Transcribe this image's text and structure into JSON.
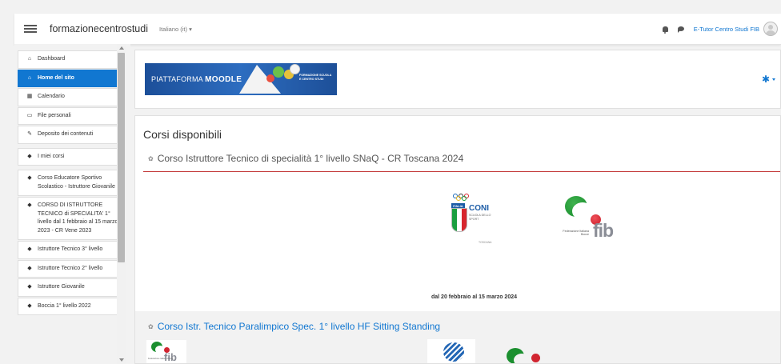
{
  "navbar": {
    "site_name": "formazionecentrostudi",
    "language": "Italiano (it) ▾",
    "user_name": "E-Tutor Centro Studi FIB"
  },
  "sidebar": {
    "items": [
      {
        "label": "Dashboard",
        "icon": "dashboard-icon",
        "glyph": "⌂"
      },
      {
        "label": "Home del sito",
        "icon": "home-icon",
        "glyph": "⌂",
        "active": true
      },
      {
        "label": "Calendario",
        "icon": "calendar-icon",
        "glyph": "▦"
      },
      {
        "label": "File personali",
        "icon": "file-icon",
        "glyph": "▭"
      },
      {
        "label": "Deposito dei contenuti",
        "icon": "pencil-icon",
        "glyph": "✎"
      },
      {
        "label": "I miei corsi",
        "icon": "graduation-cap-icon",
        "glyph": "◆"
      },
      {
        "label": "Corso Educatore Sportivo Scolastico - Istruttore Giovanile",
        "icon": "graduation-cap-icon",
        "glyph": "◆"
      },
      {
        "label": "CORSO DI ISTRUTTORE TECNICO di SPECIALITA' 1° livello dal 1 febbraio al 15 marzo 2023 - CR Vene 2023",
        "icon": "graduation-cap-icon",
        "glyph": "◆"
      },
      {
        "label": "Istruttore Tecnico 3° livello",
        "icon": "graduation-cap-icon",
        "glyph": "◆"
      },
      {
        "label": "Istruttore Tecnico 2° livello",
        "icon": "graduation-cap-icon",
        "glyph": "◆"
      },
      {
        "label": "Istruttore Giovanile",
        "icon": "graduation-cap-icon",
        "glyph": "◆"
      },
      {
        "label": "Boccia 1° livello 2022",
        "icon": "graduation-cap-icon",
        "glyph": "◆"
      }
    ]
  },
  "header": {
    "banner_text_prefix": "PIATTAFORMA",
    "banner_text_brand": "MOODLE",
    "banner_side_text": "FORMAZIONE SCUOLA E CENTRO STUDI"
  },
  "main": {
    "section_title": "Corsi disponibili",
    "course1": {
      "title": "Corso Istruttore Tecnico di specialità 1° livello SNaQ - CR Toscana 2024",
      "coni_tag": "ITALIA",
      "coni_name": "CONI",
      "coni_sub": "SCUOLA DELLO SPORT",
      "coni_region": "TOSCANA",
      "fib_name": "fib",
      "fib_sub": "Federazione Italiana Bocce",
      "dates": "dal 20 febbraio al 15 marzo 2024"
    },
    "course2": {
      "title": "Corso Istr. Tecnico Paralimpico Spec. 1° livello HF Sitting Standing",
      "fib_name": "fib",
      "fib_sub": "Federazione Italiana Bocce"
    }
  },
  "colors": {
    "accent": "#1177d1",
    "divider": "#c43b3b"
  }
}
